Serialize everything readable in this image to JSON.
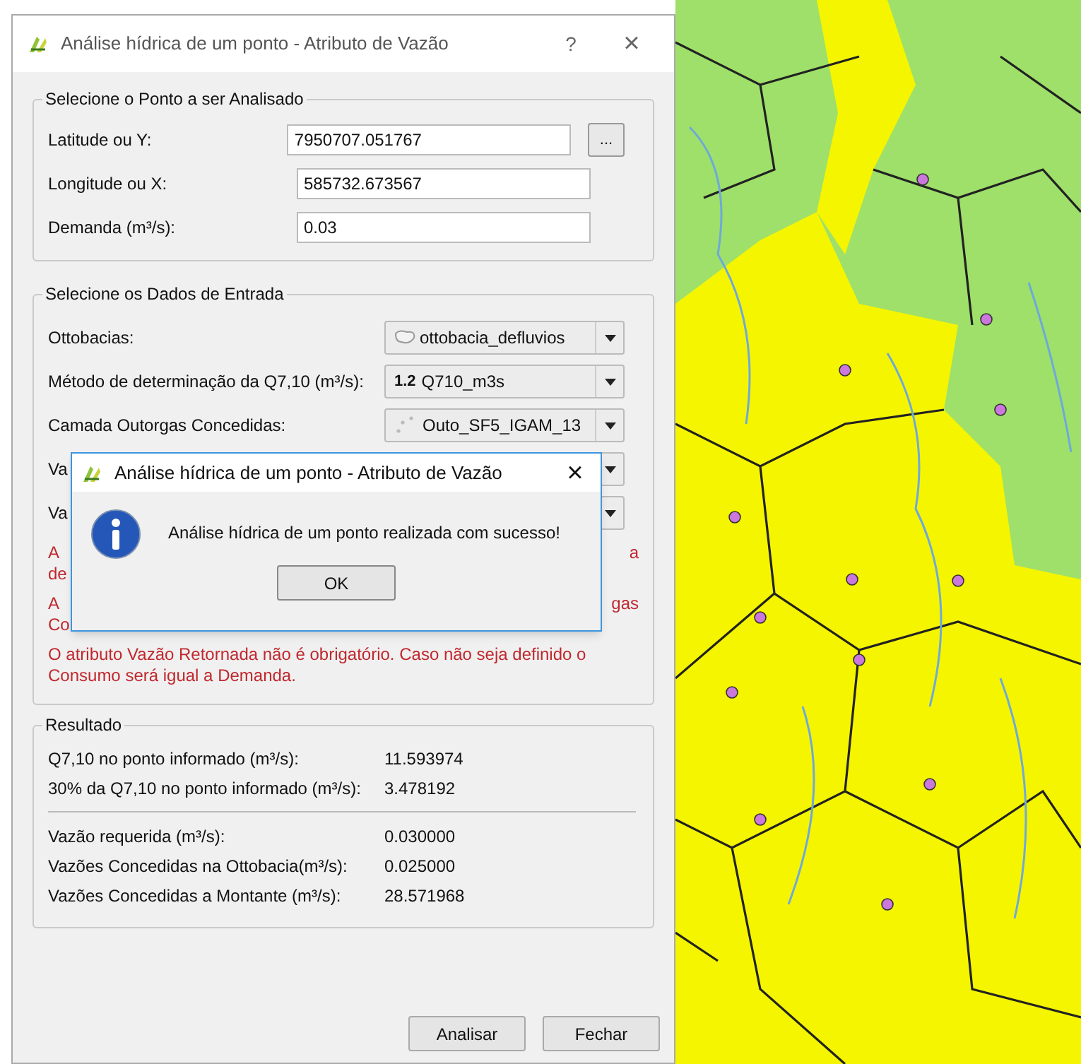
{
  "window": {
    "title": "Análise hídrica de um ponto - Atributo de Vazão",
    "help": "?",
    "close": "×"
  },
  "point_group": {
    "title": "Selecione o Ponto a ser Analisado",
    "fields": [
      {
        "label": "Latitude ou Y:",
        "value": "7950707.051767",
        "browse": "..."
      },
      {
        "label": "Longitude ou X:",
        "value": "585732.673567"
      },
      {
        "label": "Demanda (m³/s):",
        "value": "0.03"
      }
    ]
  },
  "input_group": {
    "title": "Selecione os Dados de Entrada",
    "rows": [
      {
        "label": "Ottobacias:",
        "value": "ottobacia_defluvios",
        "kind": "polygon"
      },
      {
        "label": "Método de determinação da Q7,10 (m³/s):",
        "value": "Q710_m3s",
        "prefix": "1.2",
        "kind": "number"
      },
      {
        "label": "Camada Outorgas Concedidas:",
        "value": "Outo_SF5_IGAM_13",
        "kind": "points"
      },
      {
        "label": "Va",
        "kind": "hidden"
      },
      {
        "label": "Va",
        "kind": "hidden"
      }
    ],
    "notes": [
      {
        "lines": [
          {
            "left": "A",
            "right": "a"
          },
          {
            "left": "de"
          }
        ]
      },
      {
        "lines": [
          {
            "left": "A",
            "right": "gas"
          },
          {
            "left": "Co"
          }
        ]
      },
      {
        "lines": [
          {
            "left": "O atributo Vazão Retornada não é obrigatório. Caso não seja definido o"
          },
          {
            "left": "Consumo será igual a Demanda."
          }
        ]
      }
    ]
  },
  "result_group": {
    "title": "Resultado",
    "rows": [
      {
        "label": "Q7,10 no ponto informado (m³/s):",
        "value": "11.593974"
      },
      {
        "label": "30% da Q7,10 no ponto informado (m³/s):",
        "value": "3.478192",
        "divider_after": true
      },
      {
        "label": "Vazão requerida (m³/s):",
        "value": "0.030000"
      },
      {
        "label": "Vazões Concedidas na Ottobacia(m³/s):",
        "value": "0.025000"
      },
      {
        "label": "Vazões Concedidas a Montante (m³/s):",
        "value": "28.571968"
      }
    ]
  },
  "buttons": [
    "Analisar",
    "Fechar"
  ],
  "message_box": {
    "title": "Análise hídrica de um ponto - Atributo de Vazão",
    "close": "×",
    "message": "Análise hídrica de um ponto realizada com sucesso!",
    "button": "OK"
  },
  "map": {
    "kind": "picture"
  }
}
